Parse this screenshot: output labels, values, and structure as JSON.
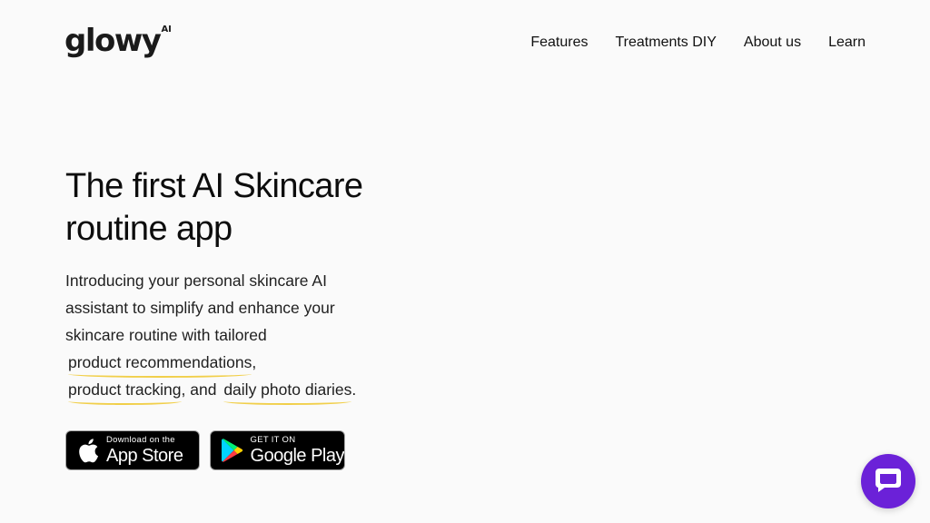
{
  "header": {
    "logo": {
      "word": "glowy",
      "superscript": "AI"
    },
    "nav": [
      {
        "label": "Features"
      },
      {
        "label": "Treatments DIY"
      },
      {
        "label": "About us"
      },
      {
        "label": "Learn"
      }
    ]
  },
  "hero": {
    "title_line1": "The first AI Skincare",
    "title_line2": "routine app",
    "intro_line1": "Introducing your personal skincare AI",
    "intro_line2": "assistant to simplify and enhance your",
    "intro_line3": "skincare routine with tailored",
    "highlight1": "product recommendations",
    "comma1": ",",
    "highlight2": "product tracking",
    "connector": ", and",
    "highlight3": "daily photo diaries",
    "period": "."
  },
  "stores": {
    "appstore": {
      "small": "Download on the",
      "big": "App Store"
    },
    "googleplay": {
      "small": "GET IT ON",
      "big": "Google Play"
    }
  },
  "colors": {
    "background": "#fafafa",
    "text": "#111111",
    "highlight_underline": "#f1cf4a",
    "chat_button": "#6b21d8"
  },
  "icons": {
    "apple": "apple-logo-icon",
    "play": "google-play-icon",
    "chat": "chat-bubble-icon"
  }
}
